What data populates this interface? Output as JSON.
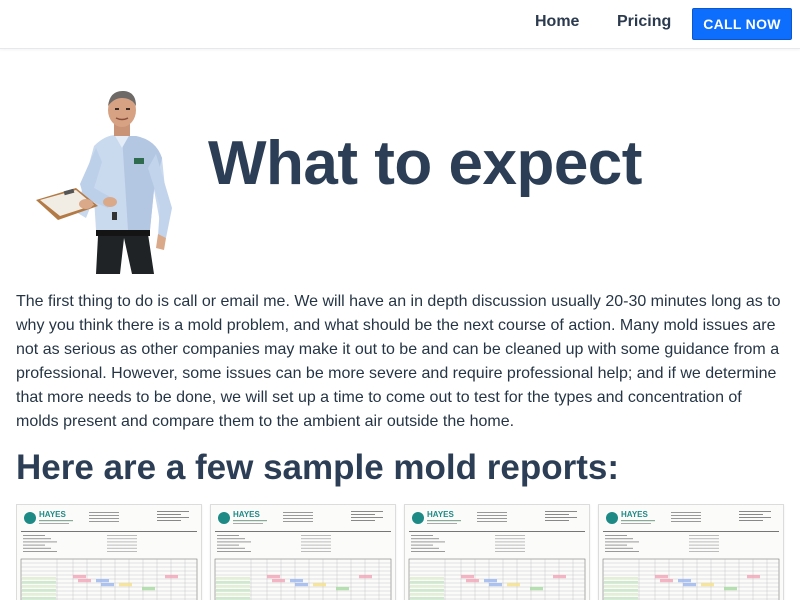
{
  "navbar": {
    "home_label": "Home",
    "pricing_label": "Pricing",
    "call_label": "CALL NOW"
  },
  "hero": {
    "title": "What to expect"
  },
  "intro": {
    "text": "The first thing to do is call or email me. We will have an in depth discussion usually 20-30 minutes long as to why you think there is a mold problem, and what should be the next course of action. Many mold issues are not as serious as other companies may make it out to be and can be cleaned up with some guidance from a professional. However, some issues can be more severe and require professional help; and if we determine that more needs to be done, we will set up a time to come out to test for the types and concentration of molds present and compare them to the ambient air outside the home."
  },
  "reports_section": {
    "title": "Here are a few sample mold reports:",
    "reports": [
      {
        "logo_text": "HAYES"
      },
      {
        "logo_text": "HAYES"
      },
      {
        "logo_text": "HAYES"
      },
      {
        "logo_text": "HAYES"
      }
    ]
  },
  "colors": {
    "accent": "#0d6efd",
    "heading": "#2c3e55",
    "logo_teal": "#1e8a86"
  }
}
